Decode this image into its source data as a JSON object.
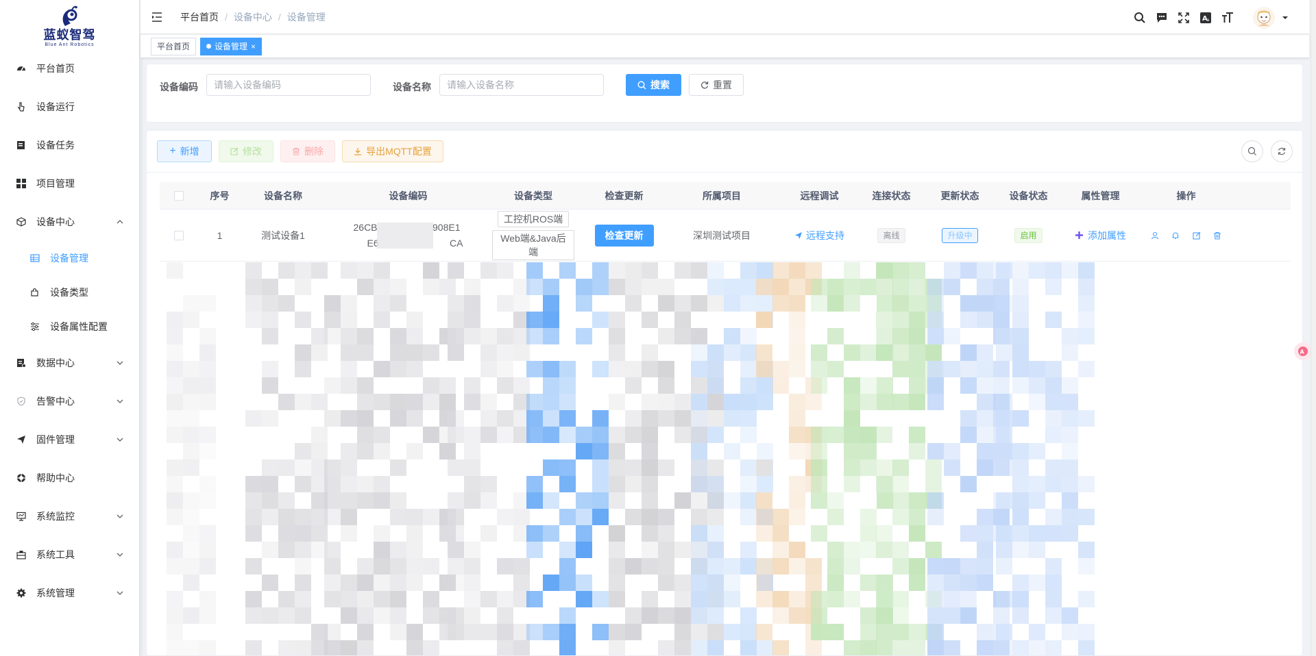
{
  "brand": {
    "name": "蓝蚁智驾",
    "subtitle": "Blue Ant Robotics",
    "color": "#1b2b7a"
  },
  "sidebar": {
    "items": [
      {
        "label": "平台首页",
        "icon": "dashboard-icon"
      },
      {
        "label": "设备运行",
        "icon": "pointer-icon"
      },
      {
        "label": "设备任务",
        "icon": "task-icon"
      },
      {
        "label": "项目管理",
        "icon": "grid-icon"
      },
      {
        "label": "设备中心",
        "icon": "cube-icon",
        "expanded": true
      },
      {
        "label": "数据中心",
        "icon": "database-icon"
      },
      {
        "label": "告警中心",
        "icon": "shield-icon"
      },
      {
        "label": "固件管理",
        "icon": "send-icon"
      },
      {
        "label": "帮助中心",
        "icon": "help-icon"
      },
      {
        "label": "系统监控",
        "icon": "monitor-icon"
      },
      {
        "label": "系统工具",
        "icon": "toolbox-icon"
      },
      {
        "label": "系统管理",
        "icon": "gear-icon"
      }
    ],
    "sub_items": [
      {
        "label": "设备管理",
        "icon": "table-icon",
        "active": true
      },
      {
        "label": "设备类型",
        "icon": "puzzle-icon"
      },
      {
        "label": "设备属性配置",
        "icon": "sliders-icon"
      }
    ]
  },
  "header": {
    "breadcrumb": [
      "平台首页",
      "设备中心",
      "设备管理"
    ],
    "icons": [
      "search-icon",
      "message-icon",
      "fullscreen-icon",
      "translate-icon",
      "font-size-icon"
    ]
  },
  "tags": {
    "items": [
      "平台首页",
      "设备管理"
    ],
    "active_index": 1,
    "close_glyph": "×"
  },
  "search": {
    "code_label": "设备编码",
    "code_placeholder": "请输入设备编码",
    "name_label": "设备名称",
    "name_placeholder": "请输入设备名称",
    "search_label": "搜索",
    "reset_label": "重置"
  },
  "toolbar": {
    "add_label": "新增",
    "edit_label": "修改",
    "delete_label": "删除",
    "export_label": "导出MQTT配置"
  },
  "table": {
    "columns": [
      "序号",
      "设备名称",
      "设备编码",
      "设备类型",
      "检查更新",
      "所属项目",
      "远程调试",
      "连接状态",
      "更新状态",
      "设备状态",
      "属性管理",
      "操作"
    ],
    "rows": [
      {
        "index": "1",
        "name": "测试设备1",
        "code_line1": "26CB",
        "code_line1_tail": "908E1",
        "code_line2": "E6",
        "code_line2_tail": "CA",
        "types": [
          "工控机ROS端",
          "Web端&Java后端"
        ],
        "check_label": "检查更新",
        "project": "深圳测试项目",
        "remote_label": "远程支持",
        "conn_status": "离线",
        "update_status": "升级中",
        "device_status": "启用",
        "attr_label": "添加属性"
      }
    ]
  },
  "colors": {
    "primary": "#409eff",
    "success": "#67c23a",
    "warning": "#e6a23c",
    "danger": "#f56c6c"
  }
}
